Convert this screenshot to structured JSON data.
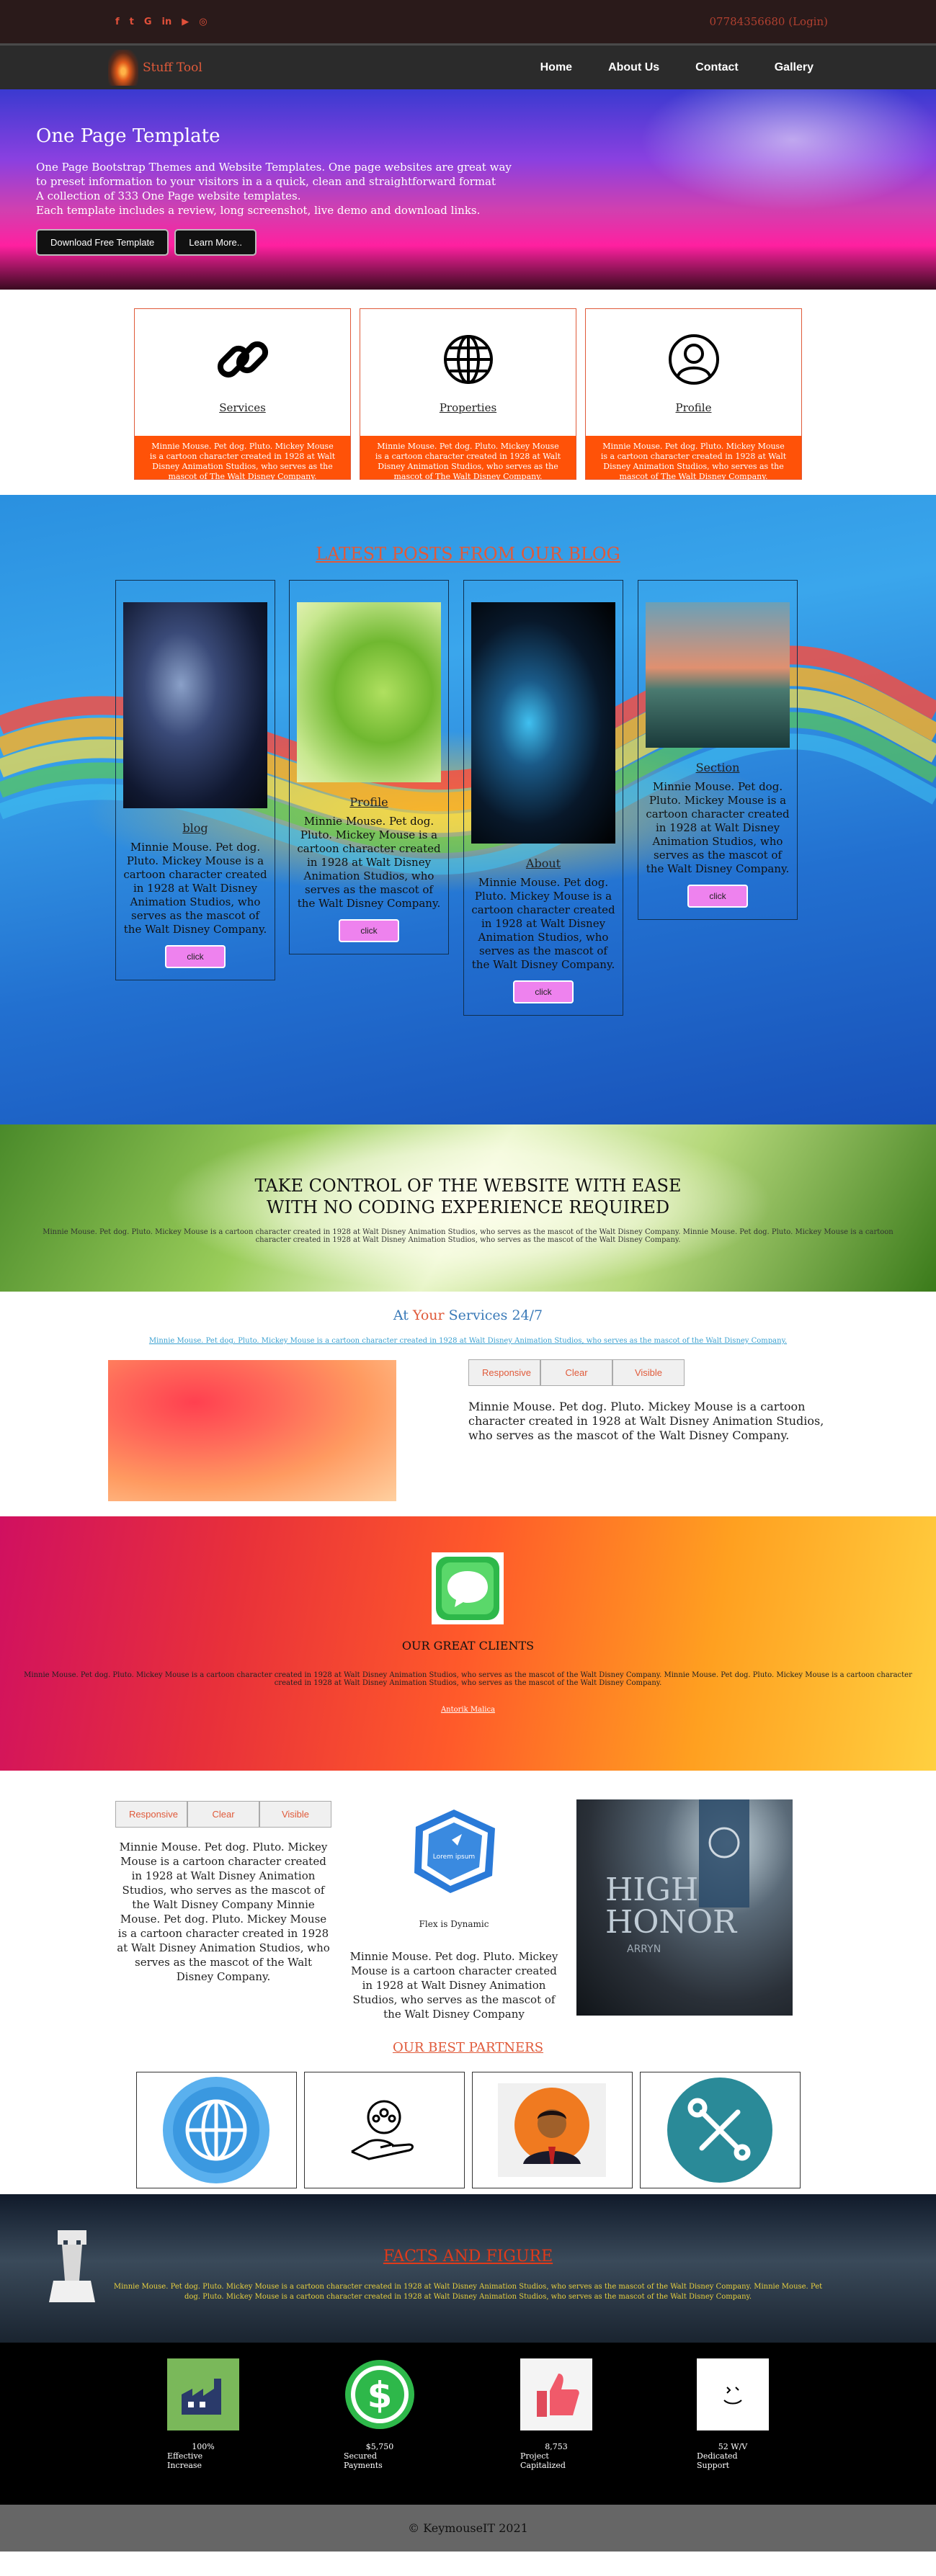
{
  "topbar": {
    "social": [
      "f",
      "t",
      "G",
      "in",
      "▶",
      "◎"
    ],
    "phone": "07784356680 (Login)"
  },
  "nav": {
    "brand": "Stuff Tool",
    "items": [
      "Home",
      "About Us",
      "Contact",
      "Gallery"
    ]
  },
  "hero": {
    "title": "One Page Template",
    "lines": [
      "One Page Bootstrap Themes and Website Templates. One page websites are great way",
      "to preset information to your visitors in a a quick, clean and straightforward format",
      "A collection of 333 One Page website templates.",
      "Each template includes a review, long screenshot, live demo and download links."
    ],
    "btn1": "Download Free Template",
    "btn2": "Learn More.."
  },
  "features": [
    {
      "label": "Services",
      "text": "Minnie Mouse. Pet dog. Pluto. Mickey Mouse is a cartoon character created in 1928 at Walt Disney Animation Studios, who serves as the mascot of The Walt Disney Company."
    },
    {
      "label": "Properties",
      "text": "Minnie Mouse. Pet dog. Pluto. Mickey Mouse is a cartoon character created in 1928 at Walt Disney Animation Studios, who serves as the mascot of The Walt Disney Company."
    },
    {
      "label": "Profile",
      "text": "Minnie Mouse. Pet dog. Pluto. Mickey Mouse is a cartoon character created in 1928 at Walt Disney Animation Studios, who serves as the mascot of The Walt Disney Company."
    }
  ],
  "blog": {
    "title": "LATEST POSTS FROM OUR BLOG",
    "cards": [
      {
        "title": "blog",
        "text": "Minnie Mouse. Pet dog. Pluto. Mickey Mouse is a cartoon character created in 1928 at Walt Disney Animation Studios, who serves as the mascot of the Walt Disney Company.",
        "btn": "click"
      },
      {
        "title": "Profile",
        "text": "Minnie Mouse. Pet dog. Pluto. Mickey Mouse is a cartoon character created in 1928 at Walt Disney Animation Studios, who serves as the mascot of the Walt Disney Company.",
        "btn": "click"
      },
      {
        "title": "About",
        "text": "Minnie Mouse. Pet dog. Pluto. Mickey Mouse is a cartoon character created in 1928 at Walt Disney Animation Studios, who serves as the mascot of the Walt Disney Company.",
        "btn": "click"
      },
      {
        "title": "Section",
        "text": "Minnie Mouse. Pet dog. Pluto. Mickey Mouse is a cartoon character created in 1928 at Walt Disney Animation Studios, who serves as the mascot of the Walt Disney Company.",
        "btn": "click"
      }
    ]
  },
  "take": {
    "line1": "TAKE CONTROL OF THE WEBSITE WITH EASE",
    "line2": "WITH NO CODING EXPERIENCE REQUIRED",
    "text": "Minnie Mouse. Pet dog. Pluto. Mickey Mouse is a cartoon character created in 1928 at Walt Disney Animation Studios, who serves as the mascot of the Walt Disney Company. Minnie Mouse. Pet dog. Pluto. Mickey Mouse is a cartoon character created in 1928 at Walt Disney Animation Studios, who serves as the mascot of the Walt Disney Company."
  },
  "services": {
    "t1": "At ",
    "t2": "Your",
    "t3": " Services 24/7",
    "link": "Minnie Mouse. Pet dog. Pluto. Mickey Mouse is a cartoon character created in 1928 at Walt Disney Animation Studios, who serves as the mascot of the Walt Disney Company.",
    "tabs": [
      "Responsive",
      "Clear",
      "Visible"
    ],
    "text": "Minnie Mouse. Pet dog. Pluto. Mickey Mouse is a cartoon character created in 1928 at Walt Disney Animation Studios, who serves as the mascot of the Walt Disney Company."
  },
  "clients": {
    "title": "OUR GREAT CLIENTS",
    "text": "Minnie Mouse. Pet dog. Pluto. Mickey Mouse is a cartoon character created in 1928 at Walt Disney Animation Studios, who serves as the mascot of the Walt Disney Company. Minnie Mouse. Pet dog. Pluto. Mickey Mouse is a cartoon character created in 1928 at Walt Disney Animation Studios, who serves as the mascot of the Walt Disney Company.",
    "who": "Antorik Malica"
  },
  "mixed": {
    "tabs": [
      "Responsive",
      "Clear",
      "Visible"
    ],
    "left_text": "Minnie Mouse. Pet dog. Pluto. Mickey Mouse is a cartoon character created in 1928 at Walt Disney Animation Studios, who serves as the mascot of the Walt Disney Company Minnie Mouse. Pet dog. Pluto. Mickey Mouse is a cartoon character created in 1928 at Walt Disney Animation Studios, who serves as the mascot of the Walt Disney Company.",
    "badge": "Lorem ipsum",
    "flex": "Flex is Dynamic",
    "mid_text": "Minnie Mouse. Pet dog. Pluto. Mickey Mouse is a cartoon character created in 1928 at Walt Disney Animation Studios, who serves as the mascot of the Walt Disney Company",
    "poster1": "HIGH",
    "poster2": "HONOR",
    "poster3": "ARRYN",
    "partners_title": "OUR BEST PARTNERS"
  },
  "facts": {
    "title": "FACTS AND FIGURE",
    "text": "Minnie Mouse. Pet dog. Pluto. Mickey Mouse is a cartoon character created in 1928 at Walt Disney Animation Studios, who serves as the mascot of the Walt Disney Company. Minnie Mouse. Pet dog. Pluto. Mickey Mouse is a cartoon character created in 1928 at Walt Disney Animation Studios, who serves as the mascot of the Walt Disney Company."
  },
  "stats": [
    {
      "n": "100%",
      "l": "Effective Increase"
    },
    {
      "n": "$5,750",
      "l": "Secured Payments"
    },
    {
      "n": "8,753",
      "l": "Project Capitalized"
    },
    {
      "n": "52 W/V",
      "l": "Dedicated Support"
    }
  ],
  "footer": {
    "text": "© KeymouseIT 2021"
  },
  "colors": {
    "accent": "#e05a3a",
    "orange": "#ff5208",
    "violet": "#ee82ee"
  }
}
